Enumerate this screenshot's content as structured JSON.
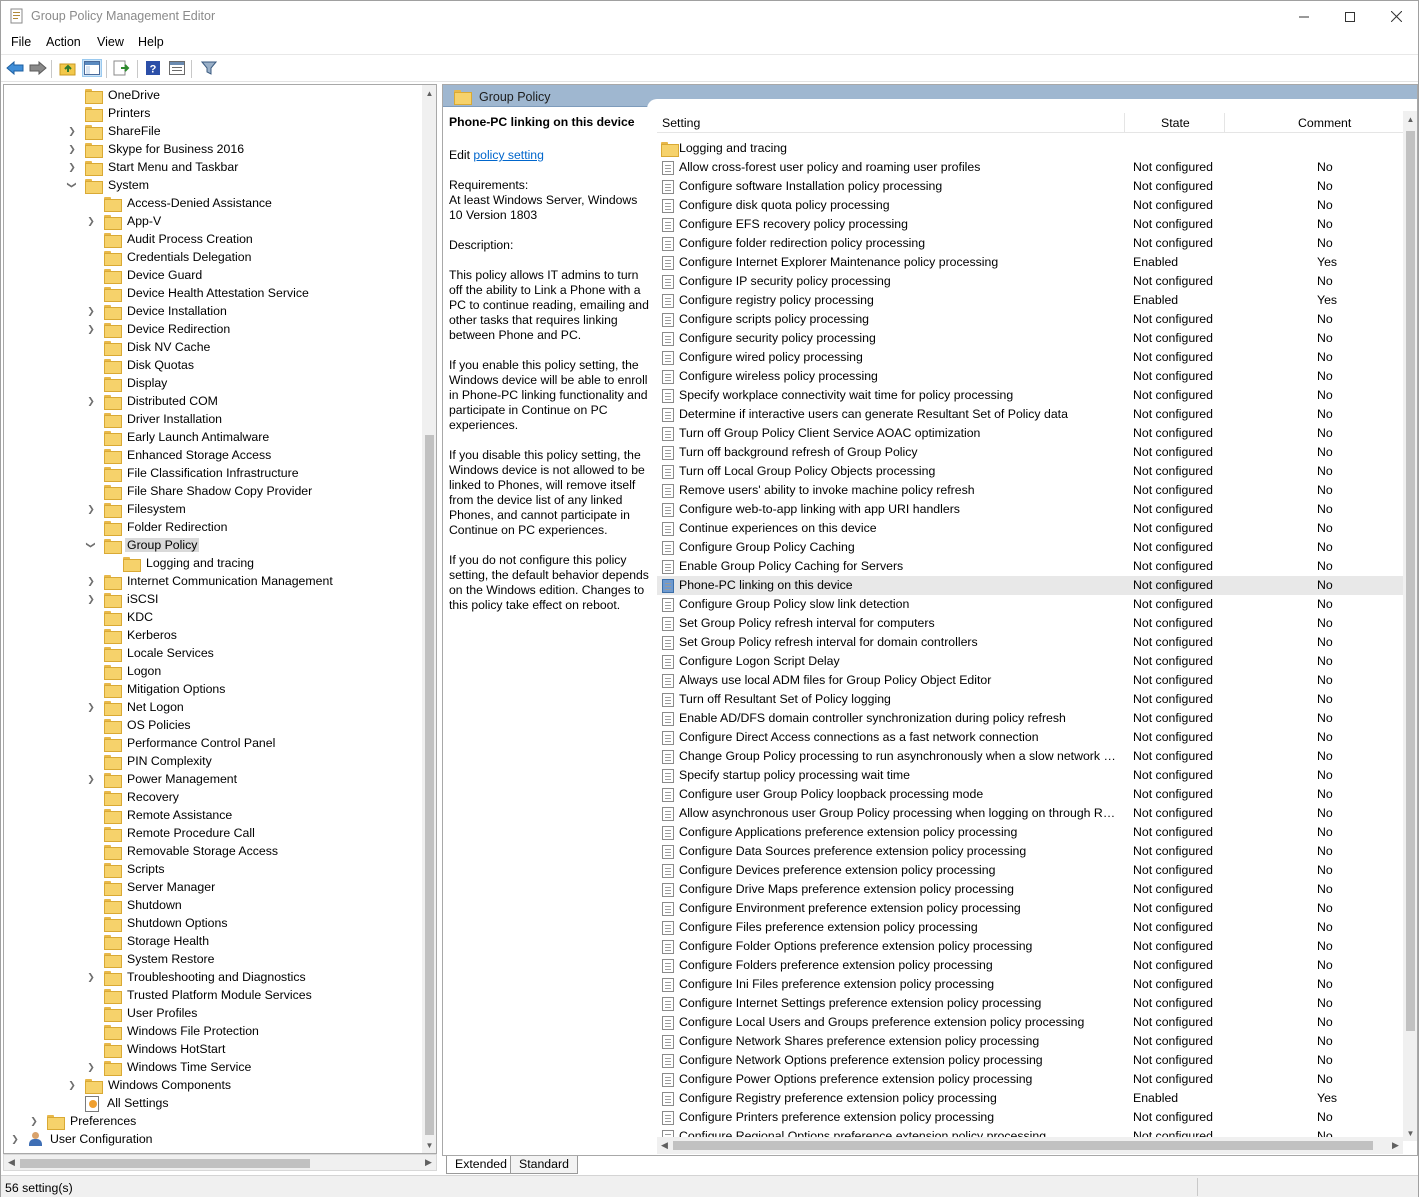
{
  "window": {
    "title": "Group Policy Management Editor"
  },
  "menu": [
    "File",
    "Action",
    "View",
    "Help"
  ],
  "tree": [
    {
      "label": "OneDrive",
      "level": 3,
      "exp": ""
    },
    {
      "label": "Printers",
      "level": 3,
      "exp": ""
    },
    {
      "label": "ShareFile",
      "level": 3,
      "exp": ">"
    },
    {
      "label": "Skype for Business 2016",
      "level": 3,
      "exp": ">"
    },
    {
      "label": "Start Menu and Taskbar",
      "level": 3,
      "exp": ">"
    },
    {
      "label": "System",
      "level": 3,
      "exp": "v"
    },
    {
      "label": "Access-Denied Assistance",
      "level": 4,
      "exp": ""
    },
    {
      "label": "App-V",
      "level": 4,
      "exp": ">"
    },
    {
      "label": "Audit Process Creation",
      "level": 4,
      "exp": ""
    },
    {
      "label": "Credentials Delegation",
      "level": 4,
      "exp": ""
    },
    {
      "label": "Device Guard",
      "level": 4,
      "exp": ""
    },
    {
      "label": "Device Health Attestation Service",
      "level": 4,
      "exp": ""
    },
    {
      "label": "Device Installation",
      "level": 4,
      "exp": ">"
    },
    {
      "label": "Device Redirection",
      "level": 4,
      "exp": ">"
    },
    {
      "label": "Disk NV Cache",
      "level": 4,
      "exp": ""
    },
    {
      "label": "Disk Quotas",
      "level": 4,
      "exp": ""
    },
    {
      "label": "Display",
      "level": 4,
      "exp": ""
    },
    {
      "label": "Distributed COM",
      "level": 4,
      "exp": ">"
    },
    {
      "label": "Driver Installation",
      "level": 4,
      "exp": ""
    },
    {
      "label": "Early Launch Antimalware",
      "level": 4,
      "exp": ""
    },
    {
      "label": "Enhanced Storage Access",
      "level": 4,
      "exp": ""
    },
    {
      "label": "File Classification Infrastructure",
      "level": 4,
      "exp": ""
    },
    {
      "label": "File Share Shadow Copy Provider",
      "level": 4,
      "exp": ""
    },
    {
      "label": "Filesystem",
      "level": 4,
      "exp": ">"
    },
    {
      "label": "Folder Redirection",
      "level": 4,
      "exp": ""
    },
    {
      "label": "Group Policy",
      "level": 4,
      "exp": "v",
      "selected": true
    },
    {
      "label": "Logging and tracing",
      "level": 5,
      "exp": ""
    },
    {
      "label": "Internet Communication Management",
      "level": 4,
      "exp": ">"
    },
    {
      "label": "iSCSI",
      "level": 4,
      "exp": ">"
    },
    {
      "label": "KDC",
      "level": 4,
      "exp": ""
    },
    {
      "label": "Kerberos",
      "level": 4,
      "exp": ""
    },
    {
      "label": "Locale Services",
      "level": 4,
      "exp": ""
    },
    {
      "label": "Logon",
      "level": 4,
      "exp": ""
    },
    {
      "label": "Mitigation Options",
      "level": 4,
      "exp": ""
    },
    {
      "label": "Net Logon",
      "level": 4,
      "exp": ">"
    },
    {
      "label": "OS Policies",
      "level": 4,
      "exp": ""
    },
    {
      "label": "Performance Control Panel",
      "level": 4,
      "exp": ""
    },
    {
      "label": "PIN Complexity",
      "level": 4,
      "exp": ""
    },
    {
      "label": "Power Management",
      "level": 4,
      "exp": ">"
    },
    {
      "label": "Recovery",
      "level": 4,
      "exp": ""
    },
    {
      "label": "Remote Assistance",
      "level": 4,
      "exp": ""
    },
    {
      "label": "Remote Procedure Call",
      "level": 4,
      "exp": ""
    },
    {
      "label": "Removable Storage Access",
      "level": 4,
      "exp": ""
    },
    {
      "label": "Scripts",
      "level": 4,
      "exp": ""
    },
    {
      "label": "Server Manager",
      "level": 4,
      "exp": ""
    },
    {
      "label": "Shutdown",
      "level": 4,
      "exp": ""
    },
    {
      "label": "Shutdown Options",
      "level": 4,
      "exp": ""
    },
    {
      "label": "Storage Health",
      "level": 4,
      "exp": ""
    },
    {
      "label": "System Restore",
      "level": 4,
      "exp": ""
    },
    {
      "label": "Troubleshooting and Diagnostics",
      "level": 4,
      "exp": ">"
    },
    {
      "label": "Trusted Platform Module Services",
      "level": 4,
      "exp": ""
    },
    {
      "label": "User Profiles",
      "level": 4,
      "exp": ""
    },
    {
      "label": "Windows File Protection",
      "level": 4,
      "exp": ""
    },
    {
      "label": "Windows HotStart",
      "level": 4,
      "exp": ""
    },
    {
      "label": "Windows Time Service",
      "level": 4,
      "exp": ">"
    },
    {
      "label": "Windows Components",
      "level": 3,
      "exp": ">"
    },
    {
      "label": "All Settings",
      "level": 3,
      "exp": "",
      "icon": "allsettings"
    },
    {
      "label": "Preferences",
      "level": 1,
      "exp": ">"
    },
    {
      "label": "User Configuration",
      "level": 0,
      "exp": ">",
      "icon": "user"
    }
  ],
  "rightHeader": "Group Policy",
  "description": {
    "title": "Phone-PC linking on this device",
    "edit_prefix": "Edit ",
    "edit_link": "policy setting ",
    "requirements": "Requirements:\nAt least Windows Server, Windows 10 Version 1803",
    "description_label": "Description:",
    "p1": "This policy allows IT admins to turn off the ability to Link a Phone with a PC to continue reading, emailing and other tasks that requires linking between Phone and PC.",
    "p2": "If you enable this policy setting, the Windows device will be able to enroll in Phone-PC linking functionality and participate in Continue on PC experiences.",
    "p3": "If you disable this policy setting, the Windows device is not allowed to be linked to Phones, will remove itself from the device list of any linked Phones, and cannot participate in Continue on PC experiences.",
    "p4": "If you do not configure this policy setting, the default behavior depends on the Windows edition. Changes to this policy take effect on reboot."
  },
  "columns": {
    "setting": "Setting",
    "state": "State",
    "comment": "Comment"
  },
  "rows": [
    {
      "name": "Logging and tracing",
      "state": "",
      "comment": "",
      "folder": true
    },
    {
      "name": "Allow cross-forest user policy and roaming user profiles",
      "state": "Not configured",
      "comment": "No"
    },
    {
      "name": "Configure software Installation policy processing",
      "state": "Not configured",
      "comment": "No"
    },
    {
      "name": "Configure disk quota policy processing",
      "state": "Not configured",
      "comment": "No"
    },
    {
      "name": "Configure EFS recovery policy processing",
      "state": "Not configured",
      "comment": "No"
    },
    {
      "name": "Configure folder redirection policy processing",
      "state": "Not configured",
      "comment": "No"
    },
    {
      "name": "Configure Internet Explorer Maintenance policy processing",
      "state": "Enabled",
      "comment": "Yes"
    },
    {
      "name": "Configure IP security policy processing",
      "state": "Not configured",
      "comment": "No"
    },
    {
      "name": "Configure registry policy processing",
      "state": "Enabled",
      "comment": "Yes"
    },
    {
      "name": "Configure scripts policy processing",
      "state": "Not configured",
      "comment": "No"
    },
    {
      "name": "Configure security policy processing",
      "state": "Not configured",
      "comment": "No"
    },
    {
      "name": "Configure wired policy processing",
      "state": "Not configured",
      "comment": "No"
    },
    {
      "name": "Configure wireless policy processing",
      "state": "Not configured",
      "comment": "No"
    },
    {
      "name": "Specify workplace connectivity wait time for policy processing",
      "state": "Not configured",
      "comment": "No"
    },
    {
      "name": "Determine if interactive users can generate Resultant Set of Policy data",
      "state": "Not configured",
      "comment": "No"
    },
    {
      "name": "Turn off Group Policy Client Service AOAC optimization",
      "state": "Not configured",
      "comment": "No"
    },
    {
      "name": "Turn off background refresh of Group Policy",
      "state": "Not configured",
      "comment": "No"
    },
    {
      "name": "Turn off Local Group Policy Objects processing",
      "state": "Not configured",
      "comment": "No"
    },
    {
      "name": "Remove users' ability to invoke machine policy refresh",
      "state": "Not configured",
      "comment": "No"
    },
    {
      "name": "Configure web-to-app linking with app URI handlers",
      "state": "Not configured",
      "comment": "No"
    },
    {
      "name": "Continue experiences on this device",
      "state": "Not configured",
      "comment": "No"
    },
    {
      "name": "Configure Group Policy Caching",
      "state": "Not configured",
      "comment": "No"
    },
    {
      "name": "Enable Group Policy Caching for Servers",
      "state": "Not configured",
      "comment": "No"
    },
    {
      "name": "Phone-PC linking on this device",
      "state": "Not configured",
      "comment": "No",
      "selected": true
    },
    {
      "name": "Configure Group Policy slow link detection",
      "state": "Not configured",
      "comment": "No"
    },
    {
      "name": "Set Group Policy refresh interval for computers",
      "state": "Not configured",
      "comment": "No"
    },
    {
      "name": "Set Group Policy refresh interval for domain controllers",
      "state": "Not configured",
      "comment": "No"
    },
    {
      "name": "Configure Logon Script Delay",
      "state": "Not configured",
      "comment": "No"
    },
    {
      "name": "Always use local ADM files for Group Policy Object Editor",
      "state": "Not configured",
      "comment": "No"
    },
    {
      "name": "Turn off Resultant Set of Policy logging",
      "state": "Not configured",
      "comment": "No"
    },
    {
      "name": "Enable AD/DFS domain controller synchronization during policy refresh",
      "state": "Not configured",
      "comment": "No"
    },
    {
      "name": "Configure Direct Access connections as a fast network connection",
      "state": "Not configured",
      "comment": "No"
    },
    {
      "name": "Change Group Policy processing to run asynchronously when a slow network con...",
      "state": "Not configured",
      "comment": "No"
    },
    {
      "name": "Specify startup policy processing wait time",
      "state": "Not configured",
      "comment": "No"
    },
    {
      "name": "Configure user Group Policy loopback processing mode",
      "state": "Not configured",
      "comment": "No"
    },
    {
      "name": "Allow asynchronous user Group Policy processing when logging on through Rem...",
      "state": "Not configured",
      "comment": "No"
    },
    {
      "name": "Configure Applications preference extension policy processing",
      "state": "Not configured",
      "comment": "No"
    },
    {
      "name": "Configure Data Sources preference extension policy processing",
      "state": "Not configured",
      "comment": "No"
    },
    {
      "name": "Configure Devices preference extension policy processing",
      "state": "Not configured",
      "comment": "No"
    },
    {
      "name": "Configure Drive Maps preference extension policy processing",
      "state": "Not configured",
      "comment": "No"
    },
    {
      "name": "Configure Environment preference extension policy processing",
      "state": "Not configured",
      "comment": "No"
    },
    {
      "name": "Configure Files preference extension policy processing",
      "state": "Not configured",
      "comment": "No"
    },
    {
      "name": "Configure Folder Options preference extension policy processing",
      "state": "Not configured",
      "comment": "No"
    },
    {
      "name": "Configure Folders preference extension policy processing",
      "state": "Not configured",
      "comment": "No"
    },
    {
      "name": "Configure Ini Files preference extension policy processing",
      "state": "Not configured",
      "comment": "No"
    },
    {
      "name": "Configure Internet Settings preference extension policy processing",
      "state": "Not configured",
      "comment": "No"
    },
    {
      "name": "Configure Local Users and Groups preference extension policy processing",
      "state": "Not configured",
      "comment": "No"
    },
    {
      "name": "Configure Network Shares preference extension policy processing",
      "state": "Not configured",
      "comment": "No"
    },
    {
      "name": "Configure Network Options preference extension policy processing",
      "state": "Not configured",
      "comment": "No"
    },
    {
      "name": "Configure Power Options preference extension policy processing",
      "state": "Not configured",
      "comment": "No"
    },
    {
      "name": "Configure Registry preference extension policy processing",
      "state": "Enabled",
      "comment": "Yes"
    },
    {
      "name": "Configure Printers preference extension policy processing",
      "state": "Not configured",
      "comment": "No"
    },
    {
      "name": "Configure Regional Options preference extension policy processing",
      "state": "Not configured",
      "comment": "No"
    }
  ],
  "viewTabs": [
    "Extended",
    "Standard"
  ],
  "status": "56 setting(s)"
}
